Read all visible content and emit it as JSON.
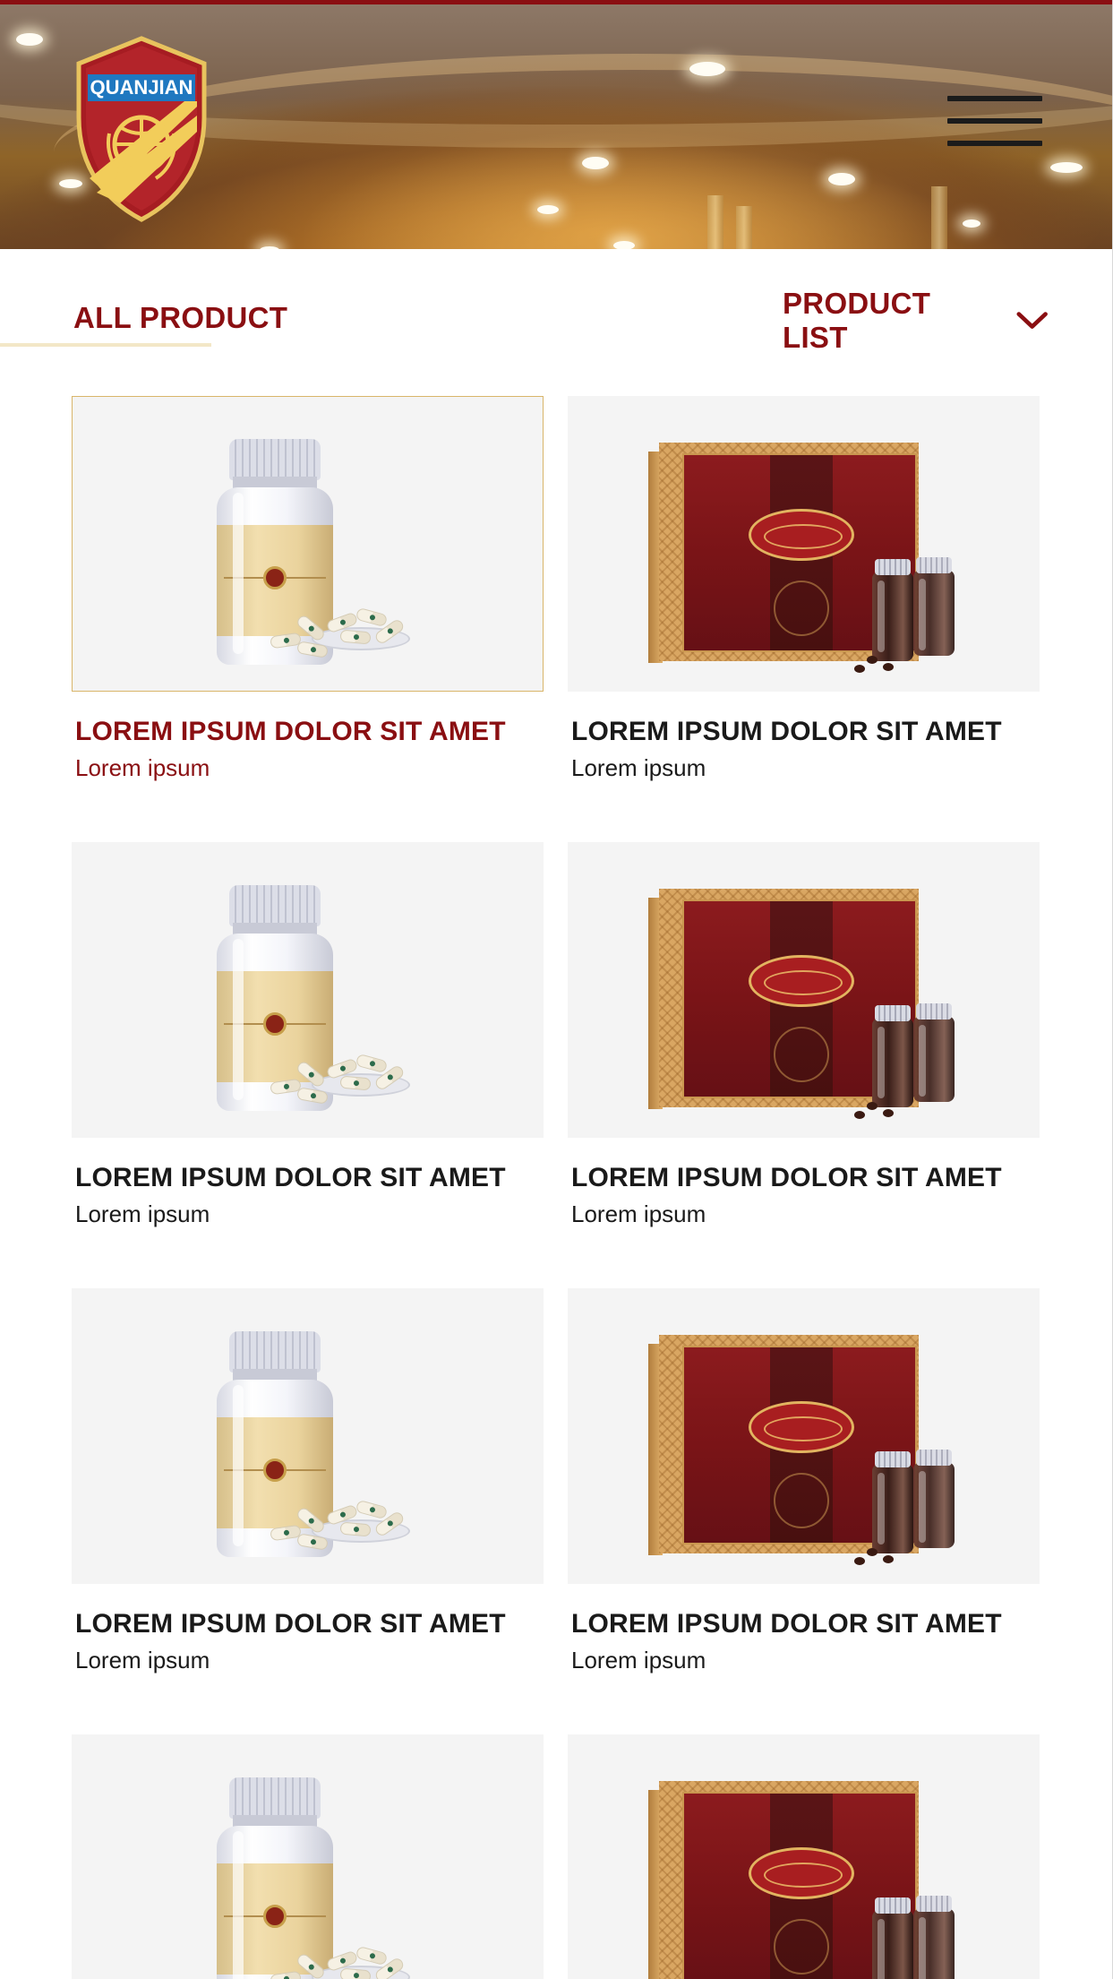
{
  "header": {
    "logo_text": "QUANJIAN",
    "menu_icon": "hamburger-menu-icon",
    "background": "banquet hall ceiling photo"
  },
  "filter_bar": {
    "all_product_label": "ALL PRODUCT",
    "product_list_label": "PRODUCT LIST",
    "dropdown_icon": "chevron-down-icon"
  },
  "colors": {
    "brand_red": "#8a0f12",
    "accent_gold": "#d9b56a",
    "card_background": "#f4f4f4",
    "text_dark": "#1a1a1a"
  },
  "products": [
    {
      "title": "LOREM IPSUM DOLOR SIT AMET",
      "subtitle": "Lorem ipsum",
      "image": "capsule-bottle",
      "selected": true
    },
    {
      "title": "LOREM IPSUM DOLOR SIT AMET",
      "subtitle": "Lorem ipsum",
      "image": "reishi-gift-box",
      "selected": false
    },
    {
      "title": "LOREM IPSUM DOLOR SIT AMET",
      "subtitle": "Lorem ipsum",
      "image": "capsule-bottle",
      "selected": false
    },
    {
      "title": "LOREM IPSUM DOLOR SIT AMET",
      "subtitle": "Lorem ipsum",
      "image": "reishi-gift-box",
      "selected": false
    },
    {
      "title": "LOREM IPSUM DOLOR SIT AMET",
      "subtitle": "Lorem ipsum",
      "image": "capsule-bottle",
      "selected": false
    },
    {
      "title": "LOREM IPSUM DOLOR SIT AMET",
      "subtitle": "Lorem ipsum",
      "image": "reishi-gift-box",
      "selected": false
    },
    {
      "title": "",
      "subtitle": "",
      "image": "capsule-bottle",
      "selected": false
    },
    {
      "title": "",
      "subtitle": "",
      "image": "reishi-gift-box",
      "selected": false
    }
  ]
}
